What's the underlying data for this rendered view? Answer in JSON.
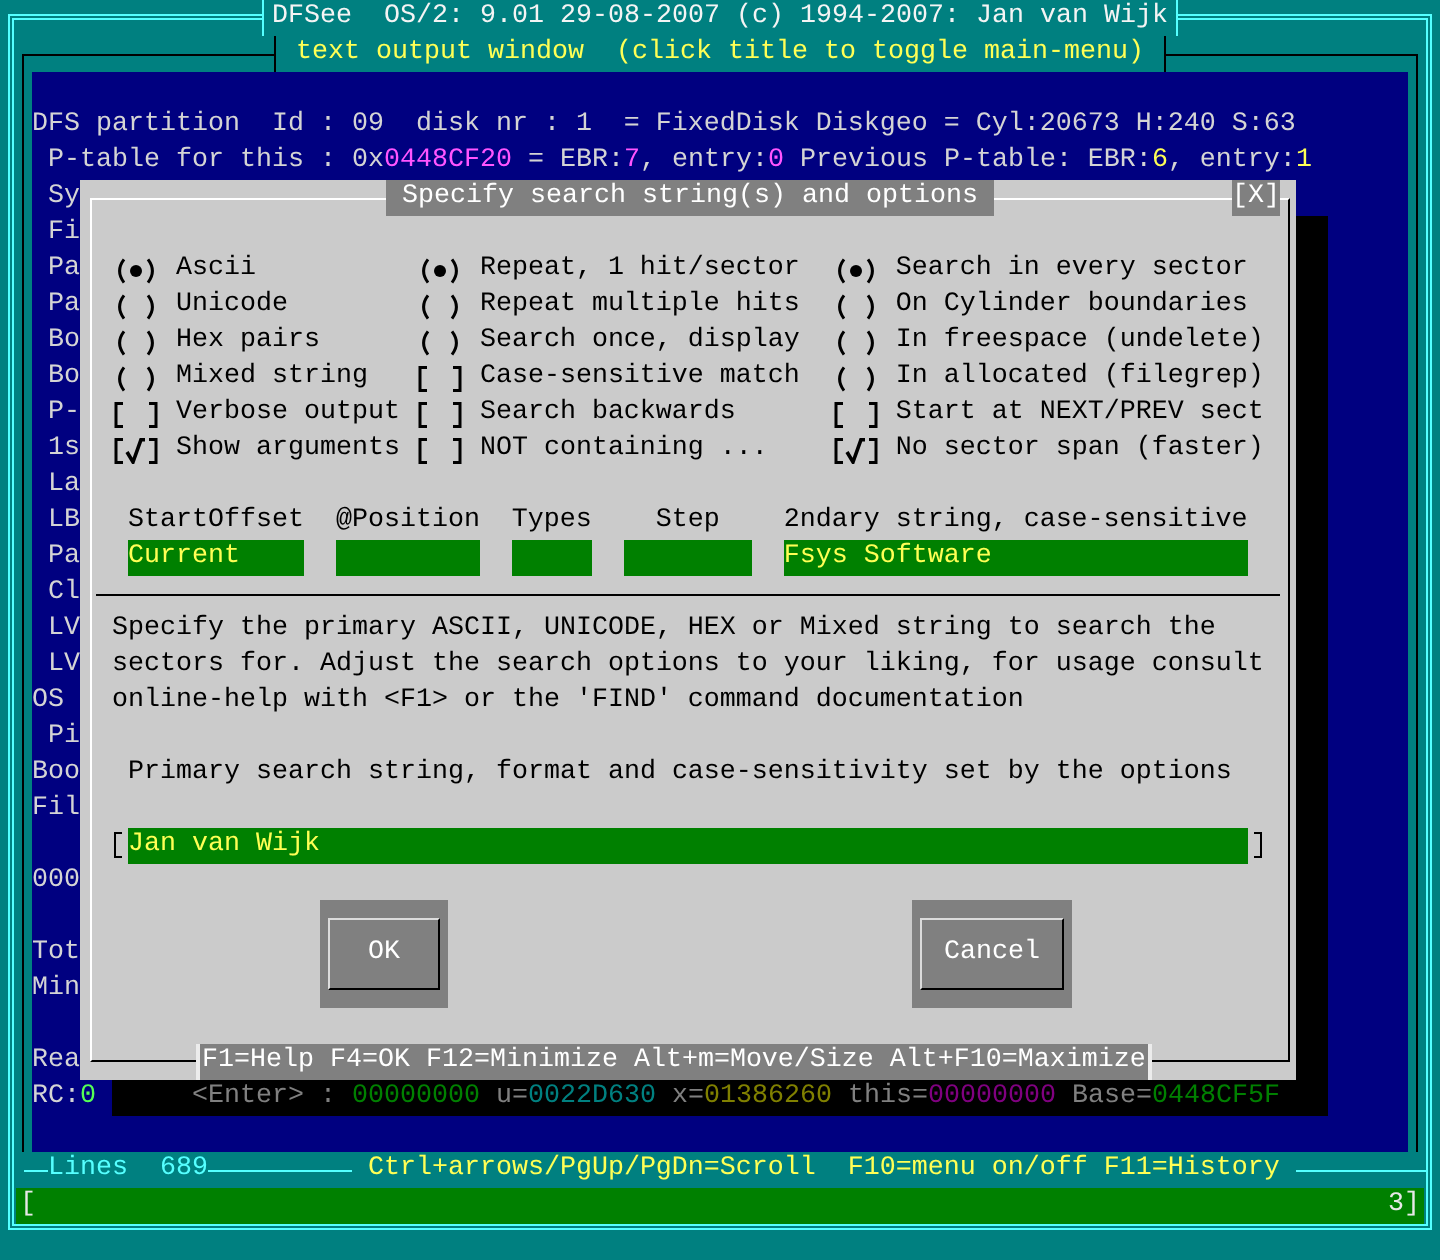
{
  "title_bar": {
    "title": "DFSee  OS/2: 9.01 29-08-2007 (c) 1994-2007: Jan van Wijk"
  },
  "output_window": {
    "title": "text output window  (click title to toggle main-menu)",
    "lines": [
      {
        "kind": "text",
        "segments": [
          {
            "text": "DFS partition  Id : 09  disk nr : 1  = FixedDisk Diskgeo = Cyl:20673 H:240 S:63"
          }
        ]
      },
      {
        "kind": "text",
        "segments": [
          {
            "text": " P-table for this : 0x"
          },
          {
            "text": "0448CF20",
            "color": "#ff55ff"
          },
          {
            "text": " = EBR:"
          },
          {
            "text": "7",
            "color": "#ff55ff"
          },
          {
            "text": ", entry:"
          },
          {
            "text": "0",
            "color": "#ff55ff"
          },
          {
            "text": " Previous P-table: EBR:"
          },
          {
            "text": "6",
            "color": "#ffff55"
          },
          {
            "text": ", entry:"
          },
          {
            "text": "1",
            "color": "#ffff55"
          }
        ]
      },
      {
        "kind": "text",
        "segments": [
          {
            "text": " Sy"
          }
        ]
      },
      {
        "kind": "text",
        "segments": [
          {
            "text": " Fi"
          }
        ]
      },
      {
        "kind": "text",
        "segments": [
          {
            "text": " Pa"
          }
        ]
      },
      {
        "kind": "text",
        "segments": [
          {
            "text": " Pa"
          }
        ]
      },
      {
        "kind": "text",
        "segments": [
          {
            "text": " Bo"
          }
        ]
      },
      {
        "kind": "text",
        "segments": [
          {
            "text": " Bo"
          }
        ]
      },
      {
        "kind": "text",
        "segments": [
          {
            "text": " P-"
          }
        ]
      },
      {
        "kind": "text",
        "segments": [
          {
            "text": " 1s"
          }
        ]
      },
      {
        "kind": "text",
        "segments": [
          {
            "text": " La"
          }
        ]
      },
      {
        "kind": "text",
        "segments": [
          {
            "text": " LB"
          }
        ]
      },
      {
        "kind": "text",
        "segments": [
          {
            "text": " Pa"
          }
        ]
      },
      {
        "kind": "text",
        "segments": [
          {
            "text": " Cl"
          }
        ]
      },
      {
        "kind": "text",
        "segments": [
          {
            "text": " LV"
          }
        ]
      },
      {
        "kind": "text",
        "segments": [
          {
            "text": " LV"
          }
        ]
      },
      {
        "kind": "text",
        "segments": [
          {
            "text": "OS"
          }
        ]
      },
      {
        "kind": "text",
        "segments": [
          {
            "text": " Pi"
          }
        ]
      },
      {
        "kind": "text",
        "segments": [
          {
            "text": "Boo"
          }
        ]
      },
      {
        "kind": "text",
        "segments": [
          {
            "text": "Fil"
          }
        ]
      },
      {
        "kind": "blank"
      },
      {
        "kind": "text",
        "segments": [
          {
            "text": "000"
          }
        ]
      },
      {
        "kind": "blank"
      },
      {
        "kind": "text",
        "segments": [
          {
            "text": "Tot"
          }
        ]
      },
      {
        "kind": "text",
        "segments": [
          {
            "text": "Min"
          }
        ]
      },
      {
        "kind": "blank"
      },
      {
        "kind": "text",
        "segments": [
          {
            "text": "Rea"
          }
        ]
      },
      {
        "kind": "prompt",
        "segments": [
          {
            "text": "RC:"
          },
          {
            "text": "0",
            "color": "#55ff55"
          }
        ],
        "shadowed_segments": [
          {
            "text": "<Enter> : "
          },
          {
            "text": "00000000",
            "color": "#008000"
          },
          {
            "text": " u="
          },
          {
            "text": "0022D630",
            "color": "#008080"
          },
          {
            "text": " x="
          },
          {
            "text": "01386260",
            "color": "#808000"
          },
          {
            "text": " this="
          },
          {
            "text": "00000000",
            "color": "#800080"
          },
          {
            "text": " Base="
          },
          {
            "text": "0448CF5F",
            "color": "#008000"
          }
        ]
      }
    ],
    "lines_label": "Lines",
    "line_count": "689",
    "key_hints": "Ctrl+arrows/PgUp/PgDn=Scroll  F10=menu on/off F11=History"
  },
  "search_dialog": {
    "title": "Specify search string(s) and options",
    "close_label": "[X]",
    "option_columns": [
      [
        {
          "kind": "radio",
          "label": "Ascii",
          "selected": true
        },
        {
          "kind": "radio",
          "label": "Unicode",
          "selected": false
        },
        {
          "kind": "radio",
          "label": "Hex pairs",
          "selected": false
        },
        {
          "kind": "radio",
          "label": "Mixed string",
          "selected": false
        },
        {
          "kind": "checkbox",
          "label": "Verbose output",
          "checked": false
        },
        {
          "kind": "checkbox",
          "label": "Show arguments",
          "checked": true
        }
      ],
      [
        {
          "kind": "radio",
          "label": "Repeat, 1 hit/sector",
          "selected": true
        },
        {
          "kind": "radio",
          "label": "Repeat multiple hits",
          "selected": false
        },
        {
          "kind": "radio",
          "label": "Search once, display",
          "selected": false
        },
        {
          "kind": "checkbox",
          "label": "Case-sensitive match",
          "checked": false
        },
        {
          "kind": "checkbox",
          "label": "Search backwards",
          "checked": false
        },
        {
          "kind": "checkbox",
          "label": "NOT containing ...",
          "checked": false
        }
      ],
      [
        {
          "kind": "radio",
          "label": "Search in every sector",
          "selected": true
        },
        {
          "kind": "radio",
          "label": "On Cylinder boundaries",
          "selected": false
        },
        {
          "kind": "radio",
          "label": "In freespace (undelete)",
          "selected": false
        },
        {
          "kind": "radio",
          "label": "In allocated (filegrep)",
          "selected": false
        },
        {
          "kind": "checkbox",
          "label": "Start at NEXT/PREV sect",
          "checked": false
        },
        {
          "kind": "checkbox",
          "label": "No sector span (faster)",
          "checked": true
        }
      ]
    ],
    "fields": [
      {
        "label": "StartOffset",
        "value": "Current"
      },
      {
        "label": "@Position"
      },
      {
        "label": "Types"
      },
      {
        "label": "Step"
      },
      {
        "label": "2ndary string, case-sensitive",
        "value": "Fsys Software"
      }
    ],
    "help_text": "Specify the primary ASCII, UNICODE, HEX or Mixed string to search the sectors for. Adjust the search options to your liking, for usage consult online-help with <F1> or the 'FIND' command documentation",
    "search_label": "Primary search string, format and case-sensitivity set by the options",
    "search_value": "Jan van Wijk",
    "buttons": [
      {
        "label": "OK"
      },
      {
        "label": "Cancel"
      }
    ],
    "key_hints": "F1=Help F4=OK F12=Minimize Alt+m=Move/Size Alt+F10=Maximize"
  },
  "command_line": {
    "left_text": "[",
    "right_text": "3]"
  }
}
